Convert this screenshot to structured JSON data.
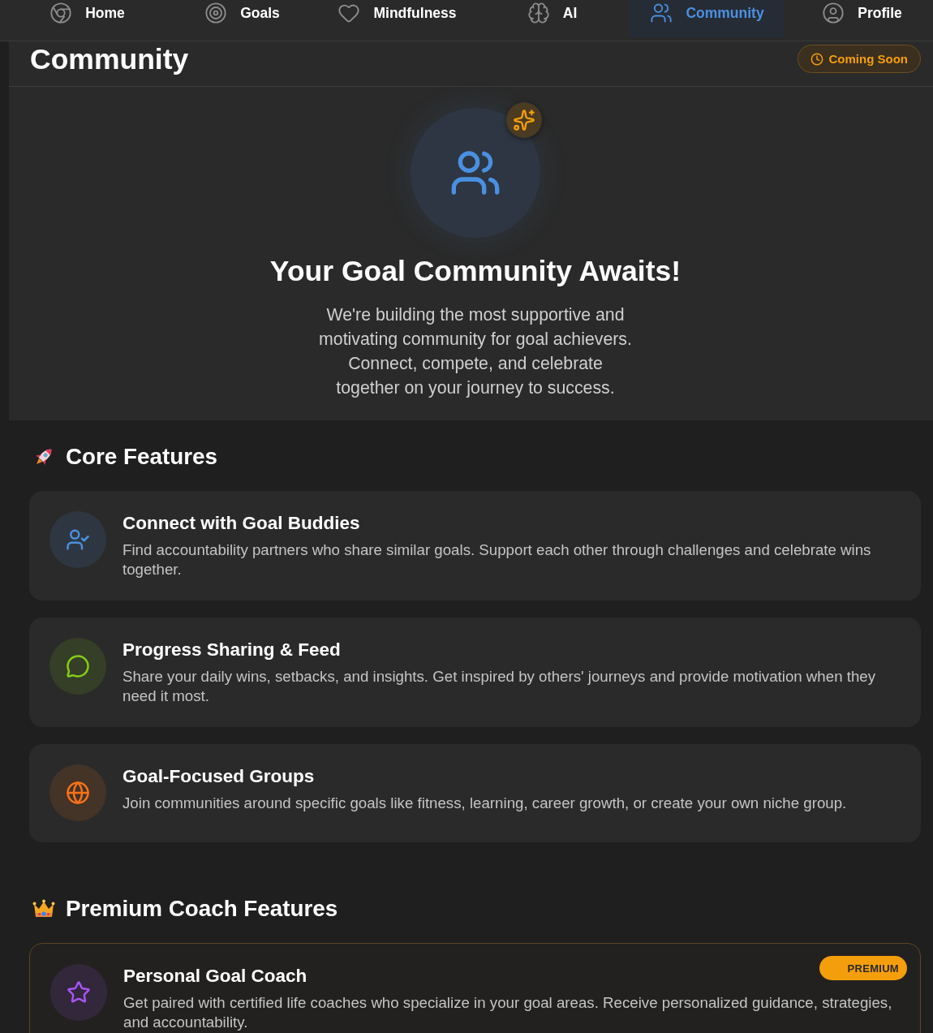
{
  "nav": {
    "tabs": [
      {
        "label": "Home",
        "selected": false
      },
      {
        "label": "Goals",
        "selected": false
      },
      {
        "label": "Mindfulness",
        "selected": false
      },
      {
        "label": "AI",
        "selected": false
      },
      {
        "label": "Community",
        "selected": true
      },
      {
        "label": "Profile",
        "selected": false
      }
    ]
  },
  "header": {
    "title": "Community",
    "badge": "Coming Soon"
  },
  "hero": {
    "title": "Your Goal Community Awaits!",
    "text": "We're building the most supportive and\nmotivating community for goal achievers.\nConnect, compete, and celebrate\ntogether on your journey to success."
  },
  "sections": [
    {
      "title": "Core Features",
      "features": [
        {
          "kind": "standard",
          "title": "Connect with Goal Buddies",
          "description": "Find accountability partners who share similar goals. Support each other through challenges and celebrate wins together.",
          "color": "#4a90e2"
        },
        {
          "kind": "standard",
          "title": "Progress Sharing & Feed",
          "description": "Share your daily wins, setbacks, and insights. Get inspired by others' journeys and provide motivation when they need it most.",
          "color": "#84cc16"
        },
        {
          "kind": "standard",
          "title": "Goal-Focused Groups",
          "description": "Join communities around specific goals like fitness, learning, career growth, or create your own niche group.",
          "color": "#f97316"
        }
      ]
    },
    {
      "title": "Premium Coach Features",
      "features": [
        {
          "kind": "premium",
          "badge": "PREMIUM",
          "title": "Personal Goal Coach",
          "description": "Get paired with certified life coaches who specialize in your goal areas. Receive personalized guidance, strategies, and accountability.",
          "color": "#a855f7"
        }
      ]
    }
  ]
}
